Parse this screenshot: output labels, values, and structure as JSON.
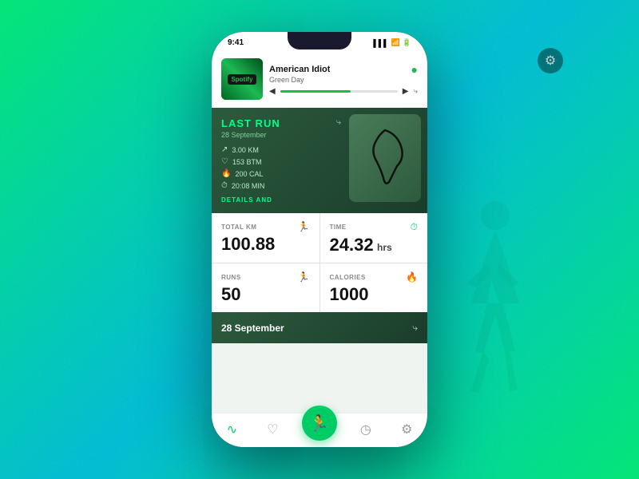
{
  "background": {
    "gradient_start": "#00e676",
    "gradient_end": "#00bcd4"
  },
  "gear_corner": {
    "icon": "⚙"
  },
  "phone": {
    "status_bar": {
      "time": "9:41",
      "icons": [
        "▌▌▌",
        "WiFi",
        "🔋"
      ]
    },
    "music": {
      "song_title": "American Idiot",
      "artist": "Green Day",
      "spotify_label": "Spotify",
      "share_icon": "⤷",
      "spotify_icon": "●"
    },
    "last_run": {
      "section_label": "LAST RUN",
      "date": "28 September",
      "share_icon": "⤷",
      "stats": [
        {
          "icon": "↗",
          "value": "3.00 KM"
        },
        {
          "icon": "♡",
          "value": "153 BTM"
        },
        {
          "icon": "🔥",
          "value": "200 CAL"
        },
        {
          "icon": "⏱",
          "value": "20:08 MIN"
        }
      ],
      "details_btn": "DETAILS AND"
    },
    "totals": [
      {
        "label": "TOTAL KM",
        "icon": "🏃",
        "value": "100.88",
        "unit": ""
      },
      {
        "label": "TIME",
        "icon": "⏱",
        "value": "24.32",
        "unit": "hrs"
      },
      {
        "label": "RUNS",
        "icon": "🏃",
        "value": "50",
        "unit": ""
      },
      {
        "label": "CALORIES",
        "icon": "🔥",
        "value": "1000",
        "unit": ""
      }
    ],
    "history": {
      "date": "28 September",
      "share_icon": "⤷"
    },
    "bottom_nav": [
      {
        "icon": "∿",
        "label": "activity",
        "active": true
      },
      {
        "icon": "♡",
        "label": "heart",
        "active": false
      },
      {
        "icon": "🏃",
        "label": "run",
        "active": false,
        "center": true
      },
      {
        "icon": "◷",
        "label": "timer",
        "active": false
      },
      {
        "icon": "⚙",
        "label": "settings",
        "active": false
      }
    ]
  }
}
